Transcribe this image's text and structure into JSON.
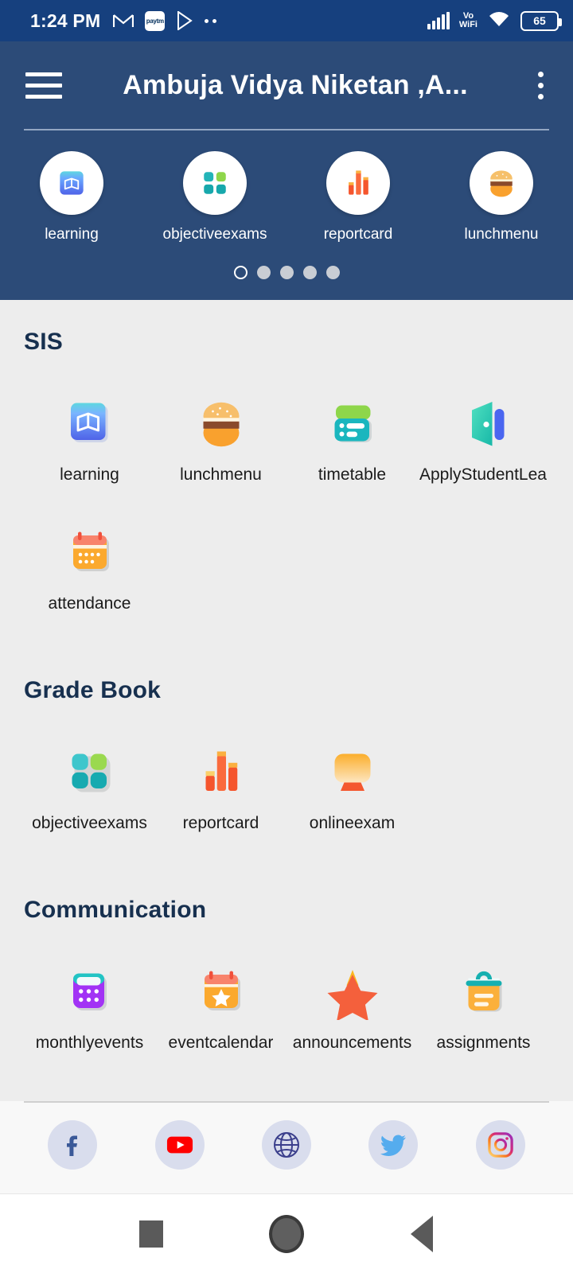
{
  "status_bar": {
    "time": "1:24 PM",
    "left_icons": [
      "gmail-icon",
      "paytm-icon",
      "play-store-icon",
      "more-notifications-icon"
    ],
    "network_label": "Vo\nWiFi",
    "volte_line1": "Vo",
    "volte_line2": "WiFi",
    "battery_percent": "65",
    "right_icons": [
      "cellular-signal-icon",
      "volte-wifi-icon",
      "wifi-icon",
      "battery-icon"
    ]
  },
  "app_bar": {
    "menu_icon": "hamburger-menu-icon",
    "title": "Ambuja Vidya Niketan ,A...",
    "overflow_icon": "kebab-menu-icon"
  },
  "carousel": {
    "items": [
      {
        "label": "learning",
        "icon": "book-icon"
      },
      {
        "label": "objectiveexams",
        "icon": "four-squares-icon"
      },
      {
        "label": "reportcard",
        "icon": "bar-chart-icon"
      },
      {
        "label": "lunchmenu",
        "icon": "burger-icon"
      }
    ],
    "page_dots": {
      "count": 5,
      "active_index": 0
    }
  },
  "sections": [
    {
      "title": "SIS",
      "tiles": [
        {
          "label": "learning",
          "icon": "book-icon"
        },
        {
          "label": "lunchmenu",
          "icon": "burger-icon"
        },
        {
          "label": "timetable",
          "icon": "timetable-icon"
        },
        {
          "label": "ApplyStudentLea...",
          "icon": "open-door-icon"
        },
        {
          "label": "attendance",
          "icon": "calendar-dots-icon"
        }
      ]
    },
    {
      "title": "Grade Book",
      "tiles": [
        {
          "label": "objectiveexams",
          "icon": "four-squares-icon"
        },
        {
          "label": "reportcard",
          "icon": "bar-chart-icon"
        },
        {
          "label": "onlineexam",
          "icon": "monitor-icon"
        }
      ]
    },
    {
      "title": "Communication",
      "tiles": [
        {
          "label": "monthlyevents",
          "icon": "calculator-icon"
        },
        {
          "label": "eventcalendar",
          "icon": "calendar-star-icon"
        },
        {
          "label": "announcements",
          "icon": "star-icon"
        },
        {
          "label": "assignments",
          "icon": "clipboard-icon"
        }
      ]
    }
  ],
  "social_bar": {
    "items": [
      {
        "name": "facebook",
        "icon": "facebook-icon"
      },
      {
        "name": "youtube",
        "icon": "youtube-icon"
      },
      {
        "name": "website",
        "icon": "globe-icon"
      },
      {
        "name": "twitter",
        "icon": "twitter-icon"
      },
      {
        "name": "instagram",
        "icon": "instagram-icon"
      }
    ]
  },
  "nav_bar": {
    "recent_icon": "recent-apps-icon",
    "home_icon": "home-icon",
    "back_icon": "back-icon"
  },
  "colors": {
    "status_bar": "#16407e",
    "app_bar": "#2c4b78",
    "page_background": "#ededed",
    "section_title": "#17304f",
    "social_bar": "#f8f8f8",
    "nav_bar": "#ffffff"
  }
}
